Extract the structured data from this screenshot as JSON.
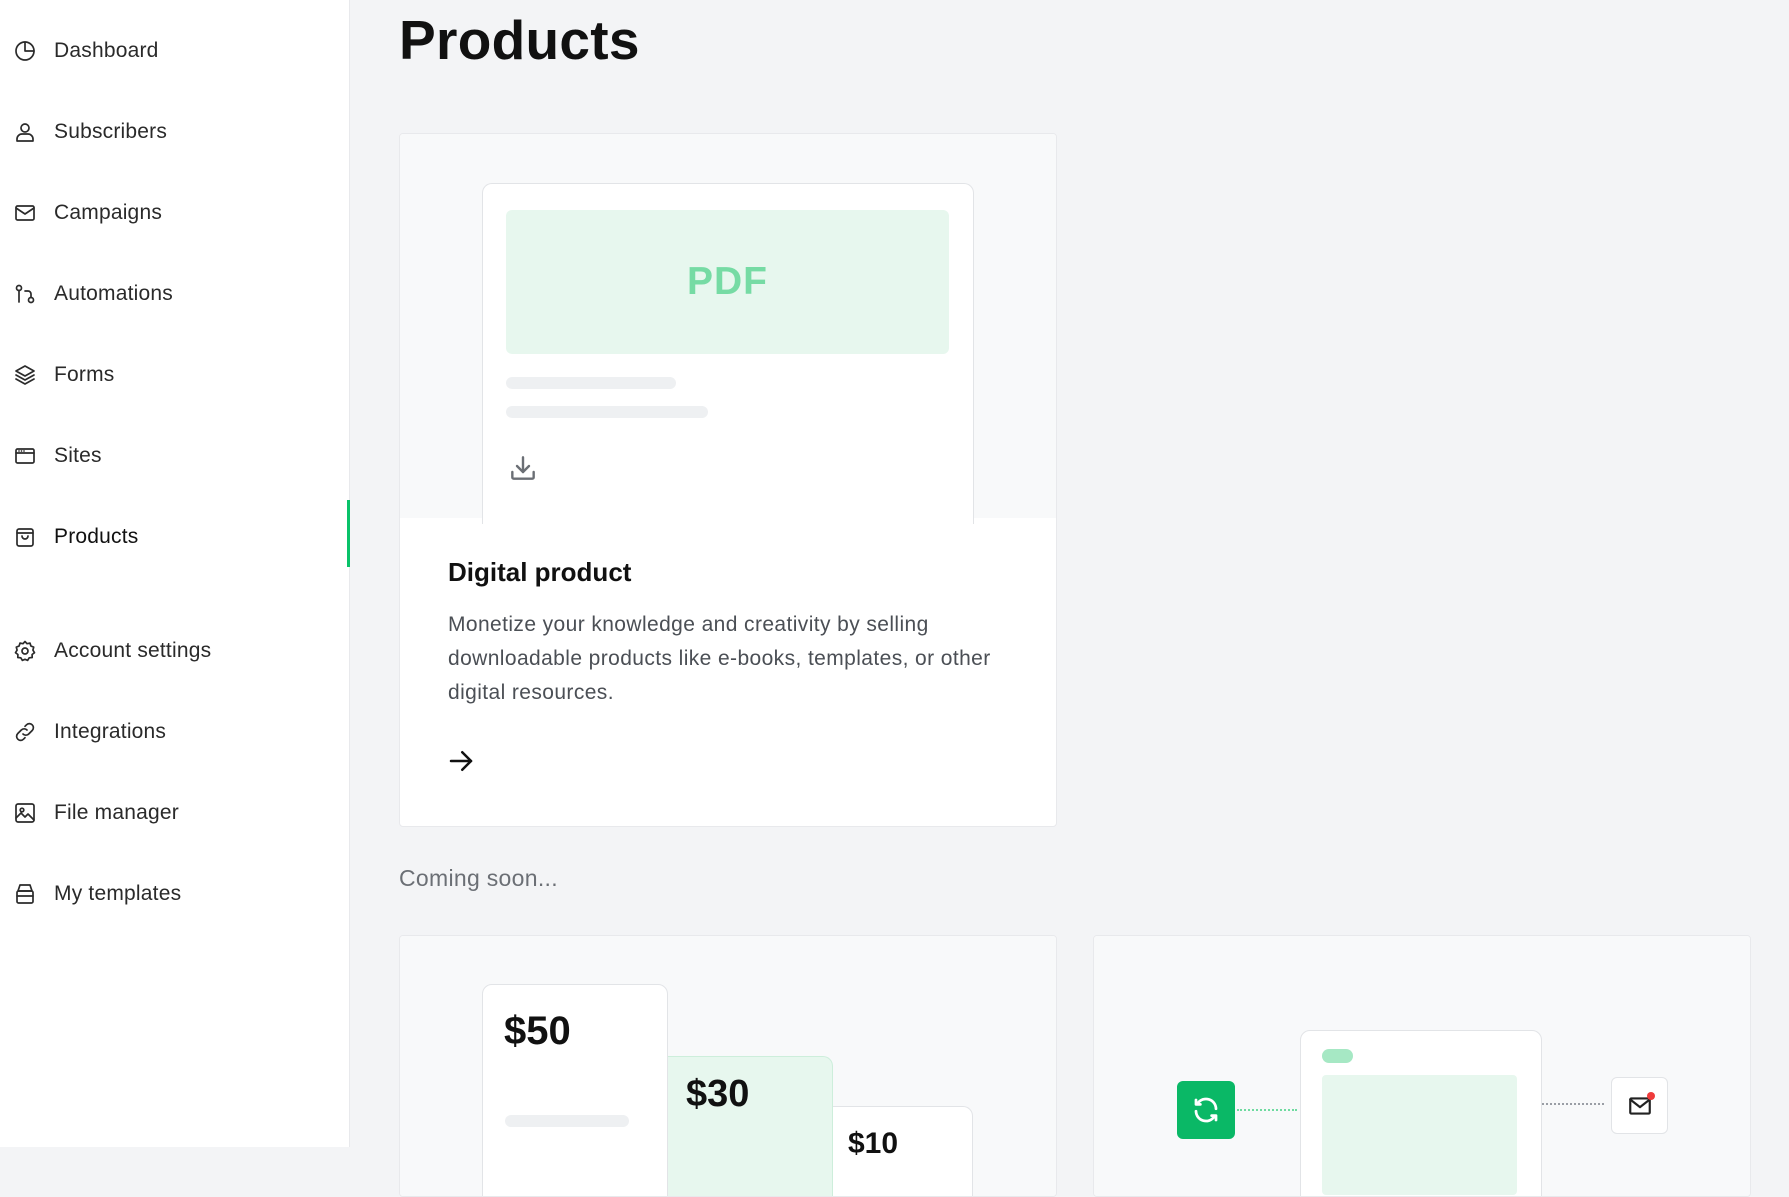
{
  "sidebar": {
    "items": [
      {
        "label": "Dashboard",
        "icon": "dashboard-icon"
      },
      {
        "label": "Subscribers",
        "icon": "user-icon"
      },
      {
        "label": "Campaigns",
        "icon": "mail-icon"
      },
      {
        "label": "Automations",
        "icon": "automation-icon"
      },
      {
        "label": "Forms",
        "icon": "layers-icon"
      },
      {
        "label": "Sites",
        "icon": "browser-icon"
      },
      {
        "label": "Products",
        "icon": "shopping-bag-icon",
        "active": true
      },
      {
        "label": "Account settings",
        "icon": "gear-icon"
      },
      {
        "label": "Integrations",
        "icon": "link-icon"
      },
      {
        "label": "File manager",
        "icon": "image-icon"
      },
      {
        "label": "My templates",
        "icon": "templates-icon"
      }
    ],
    "accent": "#09c269"
  },
  "main": {
    "title": "Products",
    "digital_product": {
      "preview_label": "PDF",
      "title": "Digital product",
      "description": "Monetize your knowledge and creativity by selling downloadable products like e-books, templates, or other digital resources.",
      "download_icon": "download-icon",
      "arrow_icon": "arrow-right-icon"
    },
    "coming_soon_label": "Coming soon...",
    "pricing_preview": {
      "prices": [
        "$50",
        "$30",
        "$10"
      ]
    },
    "automation_preview": {
      "icons": [
        "sync-icon",
        "mail-icon"
      ],
      "brand_color": "#0ab866",
      "notification_color": "#ef3b3b"
    }
  }
}
